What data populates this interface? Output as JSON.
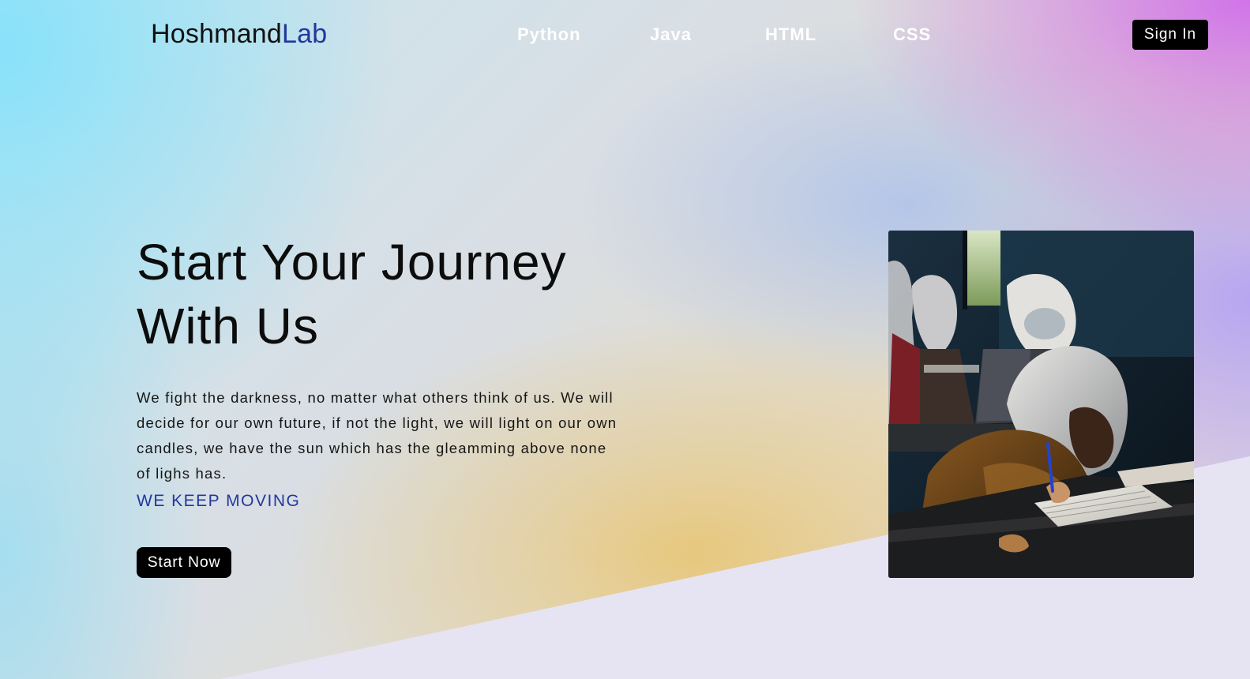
{
  "brand": {
    "name_part1": "Hoshmand",
    "name_part2": "Lab"
  },
  "nav": {
    "links": [
      "Python",
      "Java",
      "HTML",
      "CSS"
    ],
    "signin_label": "Sign In"
  },
  "hero": {
    "title_line1": "Start Your Journey",
    "title_line2": "With Us",
    "description": "We fight the darkness, no matter what others think of us. We will decide for our own future, if not the light, we will light on our own candles, we have the sun which has the gleamming above none of lighs has.",
    "tagline": "WE KEEP MOVING",
    "cta_label": "Start Now"
  },
  "colors": {
    "accent": "#23389b",
    "button_bg": "#000000",
    "lower_band": "#e6e4f3"
  }
}
